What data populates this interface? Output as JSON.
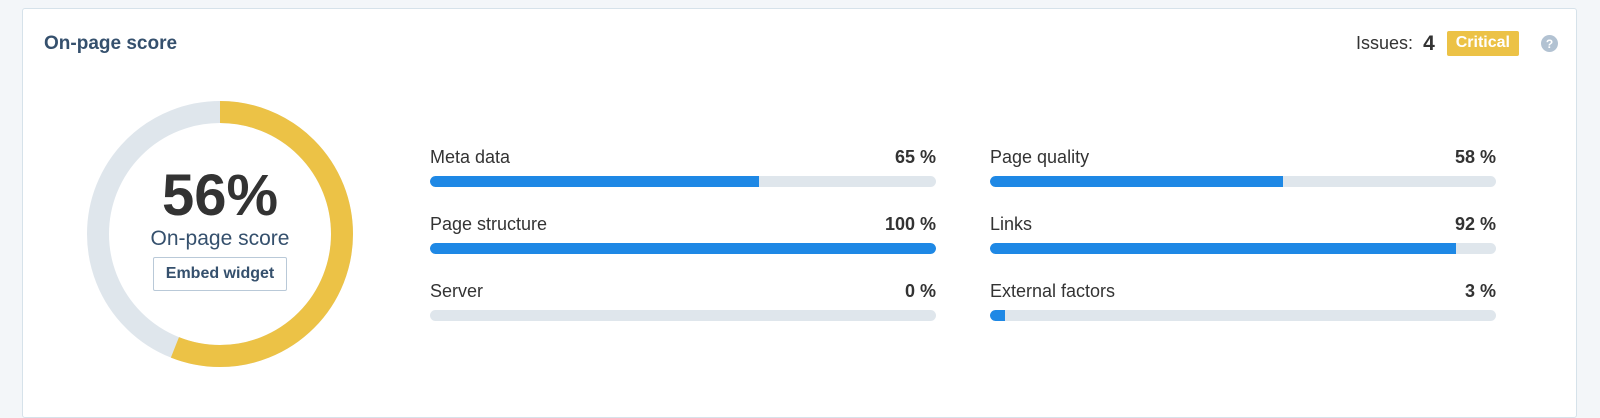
{
  "widget": {
    "title": "On-page score",
    "issues_label": "Issues:",
    "issues_count": "4",
    "severity_badge": "Critical",
    "help_glyph": "?"
  },
  "score": {
    "value_text": "56%",
    "value": 56,
    "label": "On-page score",
    "embed_button": "Embed widget",
    "colors": {
      "filled": "#ecc246",
      "empty": "#dfe6ec"
    }
  },
  "metrics": [
    {
      "name": "Meta data",
      "value_text": "65 %",
      "value": 65
    },
    {
      "name": "Page quality",
      "value_text": "58 %",
      "value": 58
    },
    {
      "name": "Page structure",
      "value_text": "100 %",
      "value": 100
    },
    {
      "name": "Links",
      "value_text": "92 %",
      "value": 92
    },
    {
      "name": "Server",
      "value_text": "0 %",
      "value": 0
    },
    {
      "name": "External factors",
      "value_text": "3 %",
      "value": 3
    }
  ],
  "colors": {
    "bar_fill": "#1e88e5",
    "bar_track": "#dfe6ec",
    "badge": "#ecc246"
  }
}
